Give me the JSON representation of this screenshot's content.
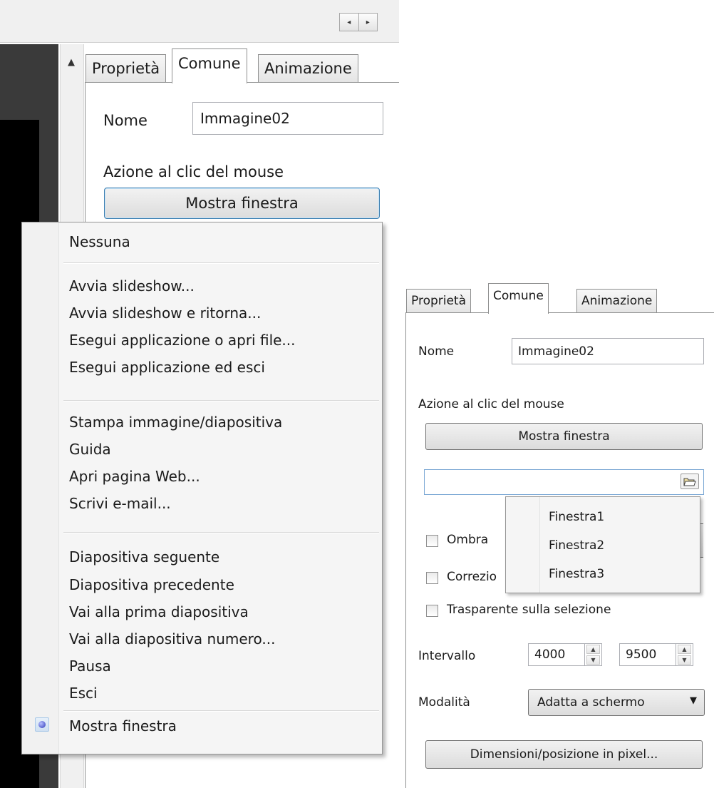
{
  "tabs": [
    "Proprietà",
    "Comune",
    "Animazione"
  ],
  "name_label": "Nome",
  "name_value": "Immagine02",
  "mouse_action_label": "Azione al clic del mouse",
  "action_button": "Mostra finestra",
  "menu": {
    "items": [
      "Nessuna",
      "Avvia slideshow...",
      "Avvia slideshow e ritorna...",
      "Esegui applicazione o apri file...",
      "Esegui applicazione ed esci",
      "Stampa immagine/diapositiva",
      "Guida",
      "Apri pagina Web...",
      "Scrivi e-mail...",
      "Diapositiva seguente",
      "Diapositiva precedente",
      "Vai alla prima diapositiva",
      "Vai alla diapositiva numero...",
      "Pausa",
      "Esci",
      "Mostra finestra"
    ],
    "selected": "Mostra finestra"
  },
  "window_path_value": "",
  "window_dropdown": [
    "Finestra1",
    "Finestra2",
    "Finestra3"
  ],
  "checkboxes": {
    "shadow": "Ombra",
    "correction_partial": "Correzio",
    "transparent": "Trasparente sulla selezione"
  },
  "interval": {
    "label": "Intervallo",
    "from": "4000",
    "to": "9500"
  },
  "mode": {
    "label": "Modalità",
    "value": "Adatta a schermo"
  },
  "size_button": "Dimensioni/posizione in pixel...",
  "icons": {
    "nav_left": "◂",
    "nav_right": "▸",
    "scroll_up": "▲",
    "combo_arrow": "▼",
    "spin_up": "▲",
    "spin_down": "▼"
  }
}
